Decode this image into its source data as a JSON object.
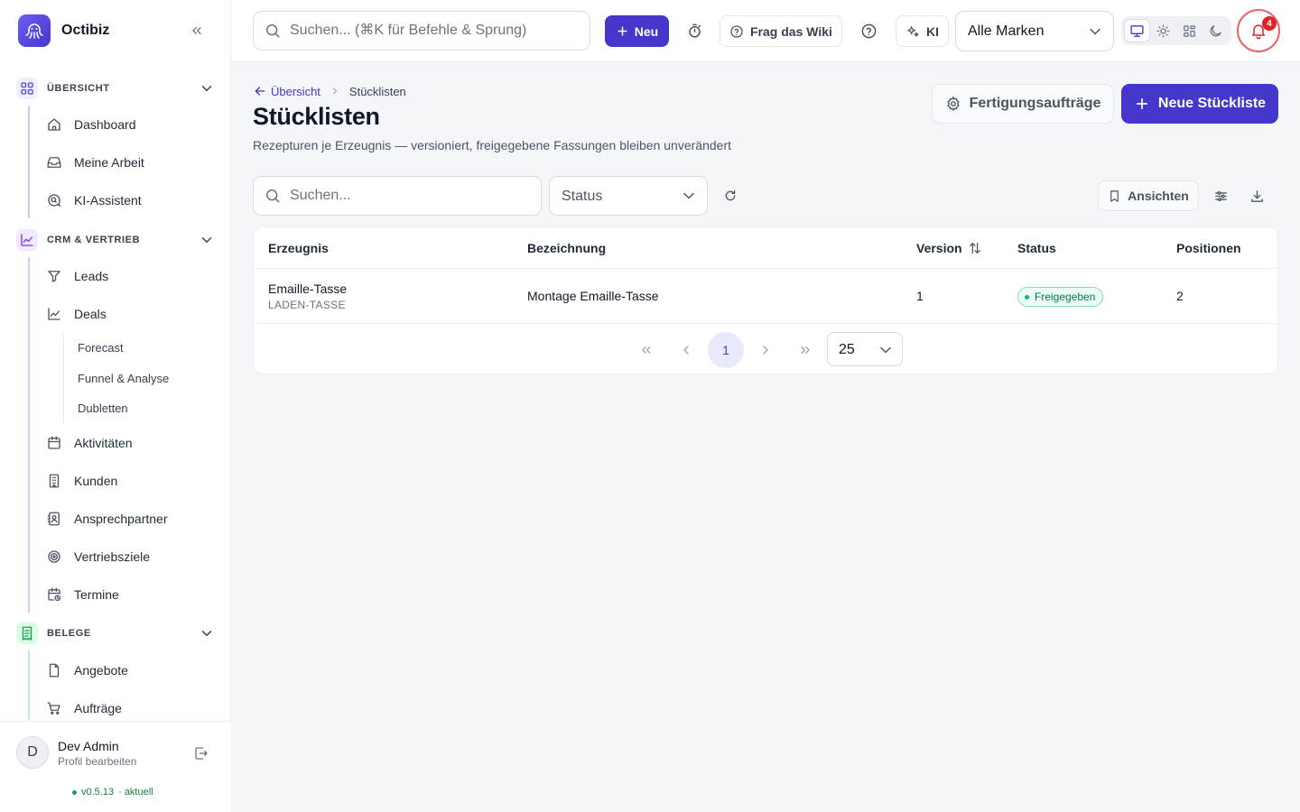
{
  "app": {
    "name": "Octibiz"
  },
  "topbar": {
    "search_placeholder": "Suchen... (⌘K für Befehle & Sprung)",
    "new_label": "Neu",
    "wiki_label": "Frag das Wiki",
    "ai_label": "KI",
    "brand_select": "Alle Marken",
    "notification_count": "4"
  },
  "sidebar": {
    "sections": [
      {
        "label": "ÜBERSICHT",
        "items": [
          "Dashboard",
          "Meine Arbeit",
          "KI-Assistent"
        ]
      },
      {
        "label": "CRM & VERTRIEB",
        "items": [
          "Leads",
          "Deals",
          "Aktivitäten",
          "Kunden",
          "Ansprechpartner",
          "Vertriebsziele",
          "Termine"
        ],
        "subitems": [
          "Forecast",
          "Funnel & Analyse",
          "Dubletten"
        ]
      },
      {
        "label": "BELEGE",
        "items": [
          "Angebote",
          "Aufträge"
        ]
      }
    ]
  },
  "user": {
    "name": "Dev Admin",
    "initial": "D",
    "subtitle": "Profil bearbeiten",
    "version": "v0.5.13",
    "version_status": "· aktuell"
  },
  "page": {
    "breadcrumb_parent": "Übersicht",
    "breadcrumb_current": "Stücklisten",
    "title": "Stücklisten",
    "subtitle": "Rezepturen je Erzeugnis — versioniert, freigegebene Fassungen bleiben unverändert",
    "orders_button": "Fertigungsaufträge",
    "primary_button": "Neue Stückliste"
  },
  "filters": {
    "search_placeholder": "Suchen...",
    "status_label": "Status",
    "views_label": "Ansichten"
  },
  "table": {
    "columns": [
      "Erzeugnis",
      "Bezeichnung",
      "Version",
      "Status",
      "Positionen"
    ],
    "rows": [
      {
        "product": "Emaille-Tasse",
        "sku": "LADEN-TASSE",
        "description": "Montage Emaille-Tasse",
        "version": "1",
        "status": "Freigegeben",
        "positions": "2"
      }
    ]
  },
  "pagination": {
    "current_page": "1",
    "page_size": "25"
  },
  "colors": {
    "primary": "#4338ca",
    "success": "#10b981",
    "danger": "#dc2626"
  }
}
